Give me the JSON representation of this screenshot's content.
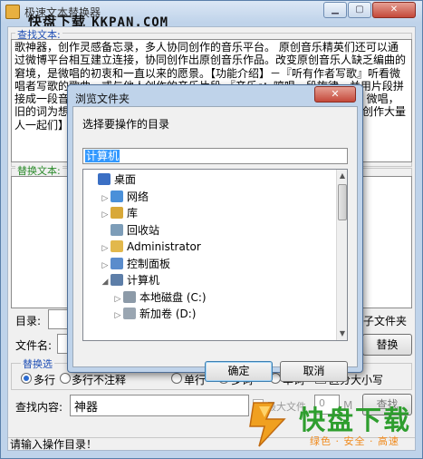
{
  "window": {
    "title": "极速文本替换器",
    "watermark_cn": "快盘下载",
    "watermark_en": "KKPAN.COM",
    "close_label": "✕"
  },
  "find_panel": {
    "legend": "查找文本:",
    "text": "歌神器，创作灵感备忘录，多人协同创作的音乐平台。 原创音乐精英们还可以通过微博平台相互建立连接，协同创作出原创音乐作品。改变原创音乐人缺乏编曲的窘境，是微唱的初衷和一直以来的愿景。【功能介绍】－『听有作者写歌』听看微唱者写歌的歌曲，或与他人创作的音乐片段 『音乐』：哼唱一段旋律，并用片段拼接成一段音乐作品，系统自动匹配旋律对号、速度)，哼唱更简单的方式。微唱，旧的词为想要的其他歌词的…在有可能的片段为音乐。有不同音乐作品，创作大量人一起们】－官方微博：微唱 微唱"
  },
  "replace_panel": {
    "legend": "替换文本:"
  },
  "dir_row": {
    "label": "目录:",
    "subfolder": "子文件夹"
  },
  "filename_row": {
    "label": "文件名:",
    "replace_button": "替换"
  },
  "options": {
    "legend": "替换选",
    "items": [
      "多行",
      "多行不注释",
      "单行",
      "多词",
      "单词",
      "区分大小写"
    ]
  },
  "search_row": {
    "label": "查找内容:",
    "value": "神器",
    "max_files_label": "最大文件",
    "max_files_value": "0",
    "unit": "M",
    "search_button": "查找"
  },
  "status": "请输入操作目录！",
  "dialog": {
    "title": "浏览文件夹",
    "close_label": "✕",
    "prompt": "选择要操作的目录",
    "path_value": "计算机",
    "tree": [
      {
        "label": "桌面",
        "arrow": "",
        "icon_color": "#3b6fc4",
        "icon": "desktop-icon"
      },
      {
        "label": "网络",
        "arrow": "▷",
        "icon_color": "#4a90d9",
        "icon": "network-icon"
      },
      {
        "label": "库",
        "arrow": "▷",
        "icon_color": "#d8a838",
        "icon": "library-icon"
      },
      {
        "label": "回收站",
        "arrow": "",
        "icon_color": "#7d9db8",
        "icon": "recycle-bin-icon"
      },
      {
        "label": "Administrator",
        "arrow": "▷",
        "icon_color": "#e2b84c",
        "icon": "user-folder-icon"
      },
      {
        "label": "控制面板",
        "arrow": "▷",
        "icon_color": "#5a8ccc",
        "icon": "control-panel-icon"
      },
      {
        "label": "计算机",
        "arrow": "◢",
        "icon_color": "#5d7ea8",
        "icon": "computer-icon"
      },
      {
        "label": "本地磁盘 (C:)",
        "arrow": "▷",
        "icon_color": "#8c9aa8",
        "icon": "local-disk-icon"
      },
      {
        "label": "新加卷 (D:)",
        "arrow": "▷",
        "icon_color": "#9aa6b2",
        "icon": "volume-icon"
      }
    ],
    "ok_button": "确定",
    "cancel_button": "取消"
  },
  "logo": {
    "name": "快盘下载",
    "tagline": "绿色 · 安全 · 高速"
  }
}
